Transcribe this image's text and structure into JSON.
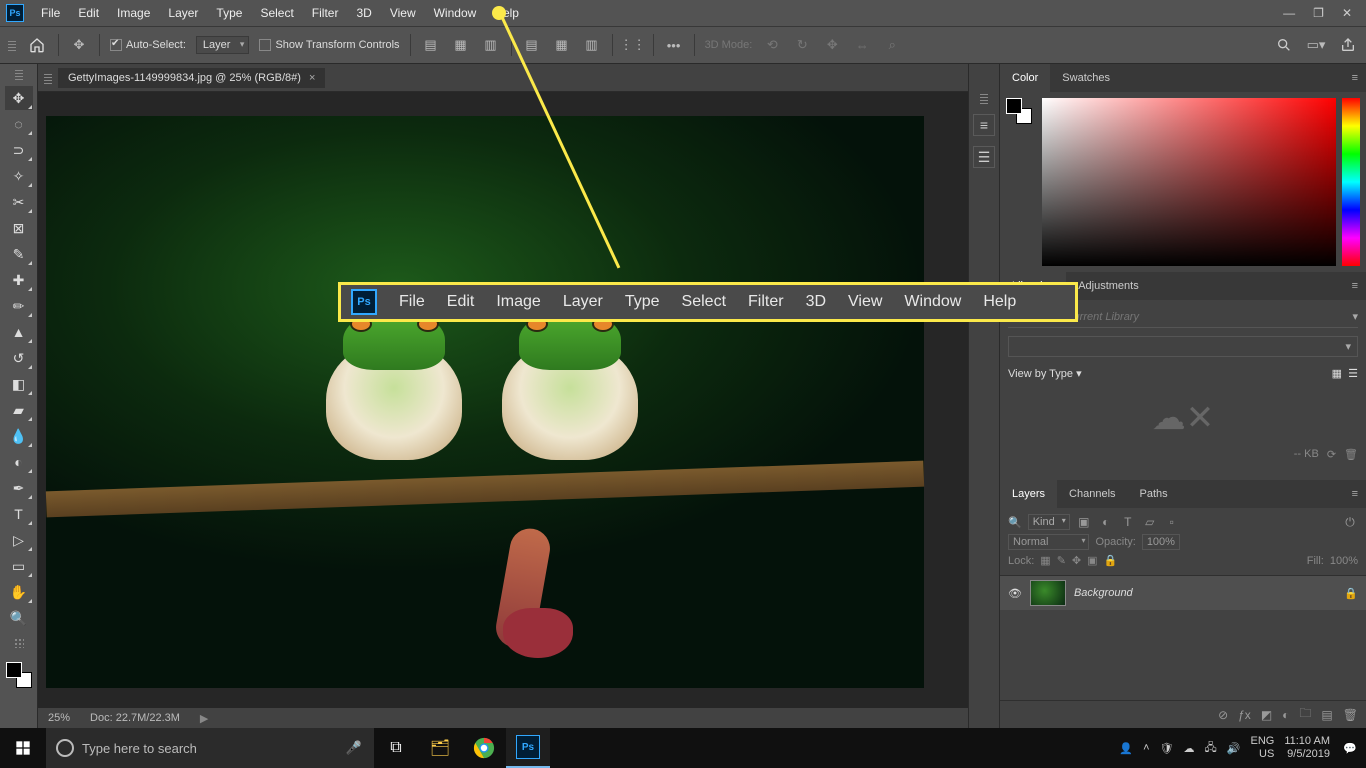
{
  "menu": {
    "items": [
      "File",
      "Edit",
      "Image",
      "Layer",
      "Type",
      "Select",
      "Filter",
      "3D",
      "View",
      "Window",
      "Help"
    ]
  },
  "options_bar": {
    "auto_select_label": "Auto-Select:",
    "auto_select_value": "Layer",
    "show_transform_label": "Show Transform Controls",
    "mode3d_label": "3D Mode:"
  },
  "document": {
    "tab_title": "GettyImages-1149999834.jpg @ 25% (RGB/8#)",
    "zoom": "25%",
    "doc_size": "Doc: 22.7M/22.3M"
  },
  "right_panels": {
    "color": {
      "tabs": [
        "Color",
        "Swatches"
      ]
    },
    "libraries": {
      "tabs": [
        "Libraries",
        "Adjustments"
      ],
      "search_placeholder": "Search Current Library",
      "view_by": "View by Type",
      "kb": "-- KB"
    },
    "layers": {
      "tabs": [
        "Layers",
        "Channels",
        "Paths"
      ],
      "kind_label": "Kind",
      "blend_mode": "Normal",
      "opacity_label": "Opacity:",
      "opacity_value": "100%",
      "lock_label": "Lock:",
      "fill_label": "Fill:",
      "fill_value": "100%",
      "layers": [
        {
          "name": "Background",
          "visible": true,
          "locked": true
        }
      ]
    }
  },
  "callout_menu": [
    "File",
    "Edit",
    "Image",
    "Layer",
    "Type",
    "Select",
    "Filter",
    "3D",
    "View",
    "Window",
    "Help"
  ],
  "taskbar": {
    "search_placeholder": "Type here to search",
    "lang1": "ENG",
    "lang2": "US",
    "time": "11:10 AM",
    "date": "9/5/2019"
  }
}
